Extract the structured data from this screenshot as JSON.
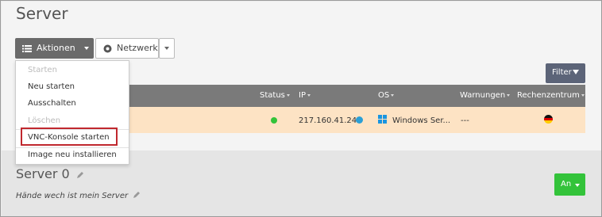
{
  "page": {
    "title": "Server"
  },
  "toolbar": {
    "actions_label": "Aktionen",
    "network_label": "Netzwerk",
    "filter_label": "Filter"
  },
  "dropdown": {
    "items": [
      {
        "label": "Starten",
        "disabled": true
      },
      {
        "label": "Neu starten",
        "disabled": false
      },
      {
        "label": "Ausschalten",
        "disabled": false
      },
      {
        "label": "Löschen",
        "disabled": true
      },
      {
        "label": "VNC-Konsole starten",
        "disabled": false,
        "highlighted": true
      },
      {
        "label": "Image neu installieren",
        "disabled": false
      }
    ]
  },
  "table": {
    "columns": [
      "Status",
      "IP",
      "OS",
      "Warnungen",
      "Rechenzentrum"
    ],
    "rows": [
      {
        "status": "online",
        "ip": "217.160.41.244",
        "os": "Windows Ser...",
        "warnings": "---",
        "datacenter_flag": "germany-flag-icon"
      }
    ]
  },
  "server_detail": {
    "name": "Server 0",
    "description": "Hände wech ist mein Server",
    "power_button_label": "An"
  },
  "colors": {
    "row_highlight": "#fde3c4",
    "status_online": "#33c33a",
    "power_button": "#33c33a",
    "highlight_border": "#c0282e"
  }
}
